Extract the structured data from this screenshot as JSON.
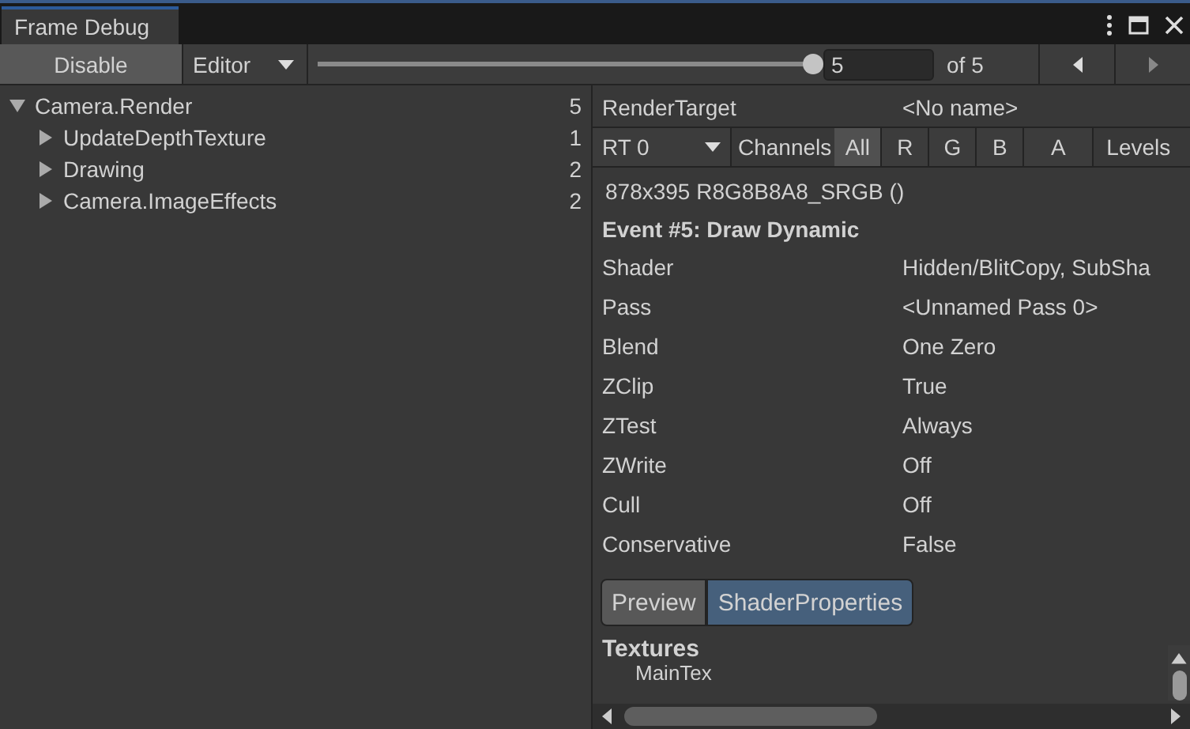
{
  "window": {
    "title": "Frame Debug"
  },
  "toolbar": {
    "enable_button": "Disable",
    "target": "Editor",
    "slider": {
      "level": 1.0
    },
    "event_field": "5",
    "event_total": "of 5"
  },
  "tree": [
    {
      "label": "Camera.Render",
      "count": "5",
      "expanded": true,
      "children": [
        {
          "label": "UpdateDepthTexture",
          "count": "1",
          "expanded": false
        },
        {
          "label": "Drawing",
          "count": "2",
          "expanded": false
        },
        {
          "label": "Camera.ImageEffects",
          "count": "2",
          "expanded": false
        }
      ]
    }
  ],
  "details": {
    "render_target": {
      "label": "RenderTarget",
      "value": "<No name>"
    },
    "rt_select": "RT 0",
    "channels_label": "Channels",
    "channels": [
      {
        "label": "All",
        "selected": true
      },
      {
        "label": "R",
        "selected": false
      },
      {
        "label": "G",
        "selected": false
      },
      {
        "label": "B",
        "selected": false
      },
      {
        "label": "A",
        "selected": false
      }
    ],
    "levels_label": "Levels",
    "format": "878x395 R8G8B8A8_SRGB ()",
    "event_title": "Event #5: Draw Dynamic",
    "properties": [
      {
        "name": "Shader",
        "value": "Hidden/BlitCopy, SubSha"
      },
      {
        "name": "Pass",
        "value": "<Unnamed Pass 0>"
      },
      {
        "name": "Blend",
        "value": "One Zero"
      },
      {
        "name": "ZClip",
        "value": "True"
      },
      {
        "name": "ZTest",
        "value": "Always"
      },
      {
        "name": "ZWrite",
        "value": "Off"
      },
      {
        "name": "Cull",
        "value": "Off"
      },
      {
        "name": "Conservative",
        "value": "False"
      }
    ],
    "tabs": [
      {
        "label": "Preview",
        "selected": false
      },
      {
        "label": "ShaderProperties",
        "selected": true
      }
    ],
    "section_title": "Textures",
    "section_items": [
      "MainTex"
    ]
  }
}
